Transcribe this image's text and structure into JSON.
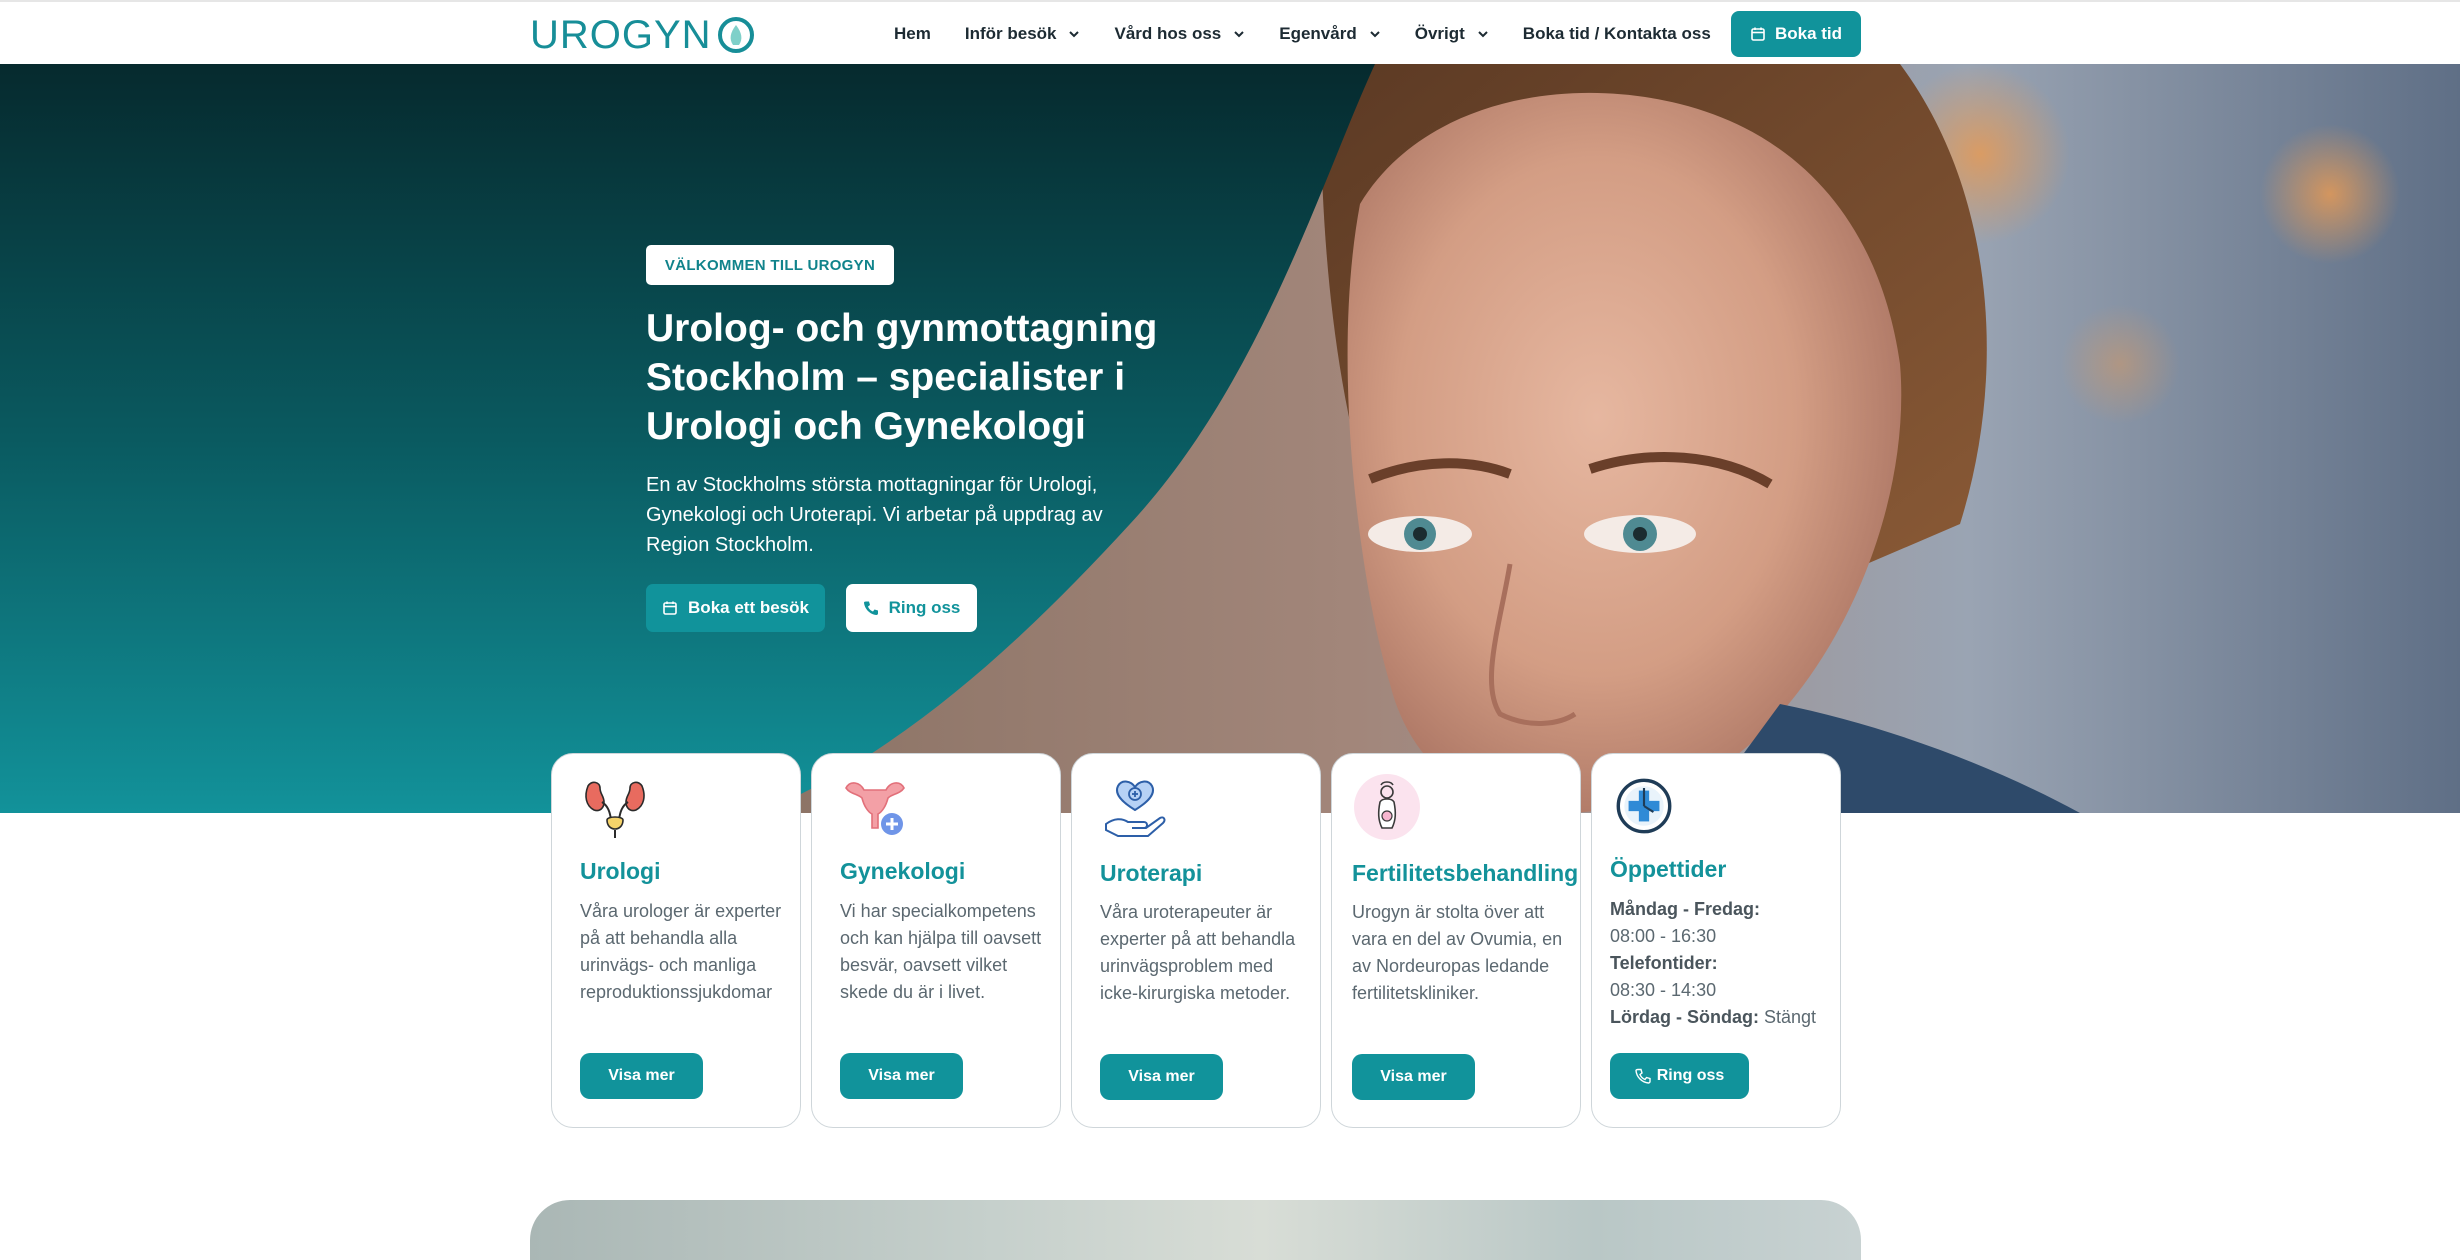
{
  "nav": {
    "logo_text": "UROGYN",
    "items": [
      {
        "label": "Hem",
        "dropdown": false
      },
      {
        "label": "Inför besök",
        "dropdown": true
      },
      {
        "label": "Vård hos oss",
        "dropdown": true
      },
      {
        "label": "Egenvård",
        "dropdown": true
      },
      {
        "label": "Övrigt",
        "dropdown": true
      },
      {
        "label": "Boka tid / Kontakta oss",
        "dropdown": false
      }
    ],
    "book_label": "Boka tid"
  },
  "hero": {
    "badge": "VÄLKOMMEN TILL UROGYN",
    "title": "Urolog- och gynmottagning Stockholm – specialister i Urologi och Gynekologi",
    "subtitle": "En av Stockholms största mottagningar för Urologi, Gynekologi och Uroterapi. Vi arbetar på uppdrag av Region Stockholm.",
    "btn_book": "Boka ett besök",
    "btn_call": "Ring oss"
  },
  "cards": [
    {
      "title": "Urologi",
      "text": "Våra urologer är experter på att behandla alla urinvägs- och manliga reproduktionssjukdomar",
      "button": "Visa mer",
      "icon": "kidney-icon"
    },
    {
      "title": "Gynekologi",
      "text": "Vi har specialkompetens och kan hjälpa till oavsett besvär, oavsett vilket skede du är i livet.",
      "button": "Visa mer",
      "icon": "uterus-icon"
    },
    {
      "title": "Uroterapi",
      "text": "Våra uroterapeuter är experter på att behandla urinvägsproblem med icke-kirurgiska metoder.",
      "button": "Visa mer",
      "icon": "heart-hand-icon"
    },
    {
      "title": "Fertilitetsbehandling",
      "text": "Urogyn är stolta över att vara en del av Ovumia, en av Nordeuropas ledande fertilitetskliniker.",
      "button": "Visa mer",
      "icon": "fertility-icon"
    }
  ],
  "hours": {
    "title": "Öppettider",
    "weekdays_label": "Måndag - Fredag:",
    "weekdays_value": "08:00 - 16:30",
    "phone_label": "Telefontider:",
    "phone_value": "08:30 - 14:30",
    "weekend_label": "Lördag - Söndag:",
    "weekend_value": "Stängt",
    "button": "Ring oss",
    "icon": "clock-cross-icon"
  },
  "colors": {
    "primary": "#11939b",
    "dark_teal": "#0a3a3e",
    "text": "#1d2b33",
    "muted_text": "#5b6870"
  }
}
